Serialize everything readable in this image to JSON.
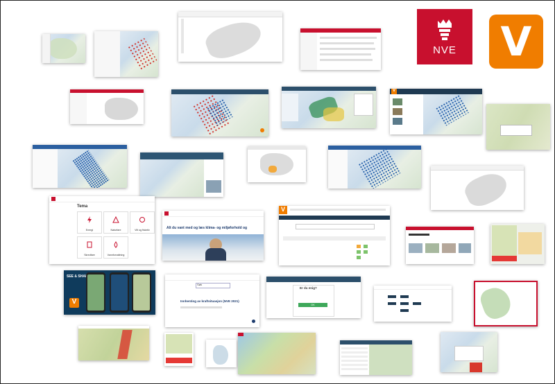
{
  "logos": {
    "nve": {
      "text": "NVE",
      "color": "#c8102e"
    },
    "varsom": {
      "text": "V",
      "color": "#f07d00"
    }
  },
  "thumbnails": {
    "temaer": {
      "title": "Tema",
      "tiles": [
        "Energi",
        "Naturfare",
        "Vilt og fiskeliv",
        "Skredfare",
        "Vannforvaltning"
      ]
    },
    "climate_banner": {
      "headline": "Alt du vant med og læs klima- og miljøforhold og"
    },
    "phone_app": {
      "title": "SEE & SHARE",
      "badge": "V"
    },
    "register_info": {
      "search_label": "Søk",
      "heading": "Innhenting av kraftsituasjon (NVE 2021)"
    },
    "green_dialog": {
      "title": "Er du enig?",
      "button": "OK"
    }
  },
  "colors": {
    "nve_red": "#c8102e",
    "varsom_orange": "#f07d00",
    "nav_dark": "#2c4f6b",
    "accent_blue": "#1e5aa8"
  }
}
